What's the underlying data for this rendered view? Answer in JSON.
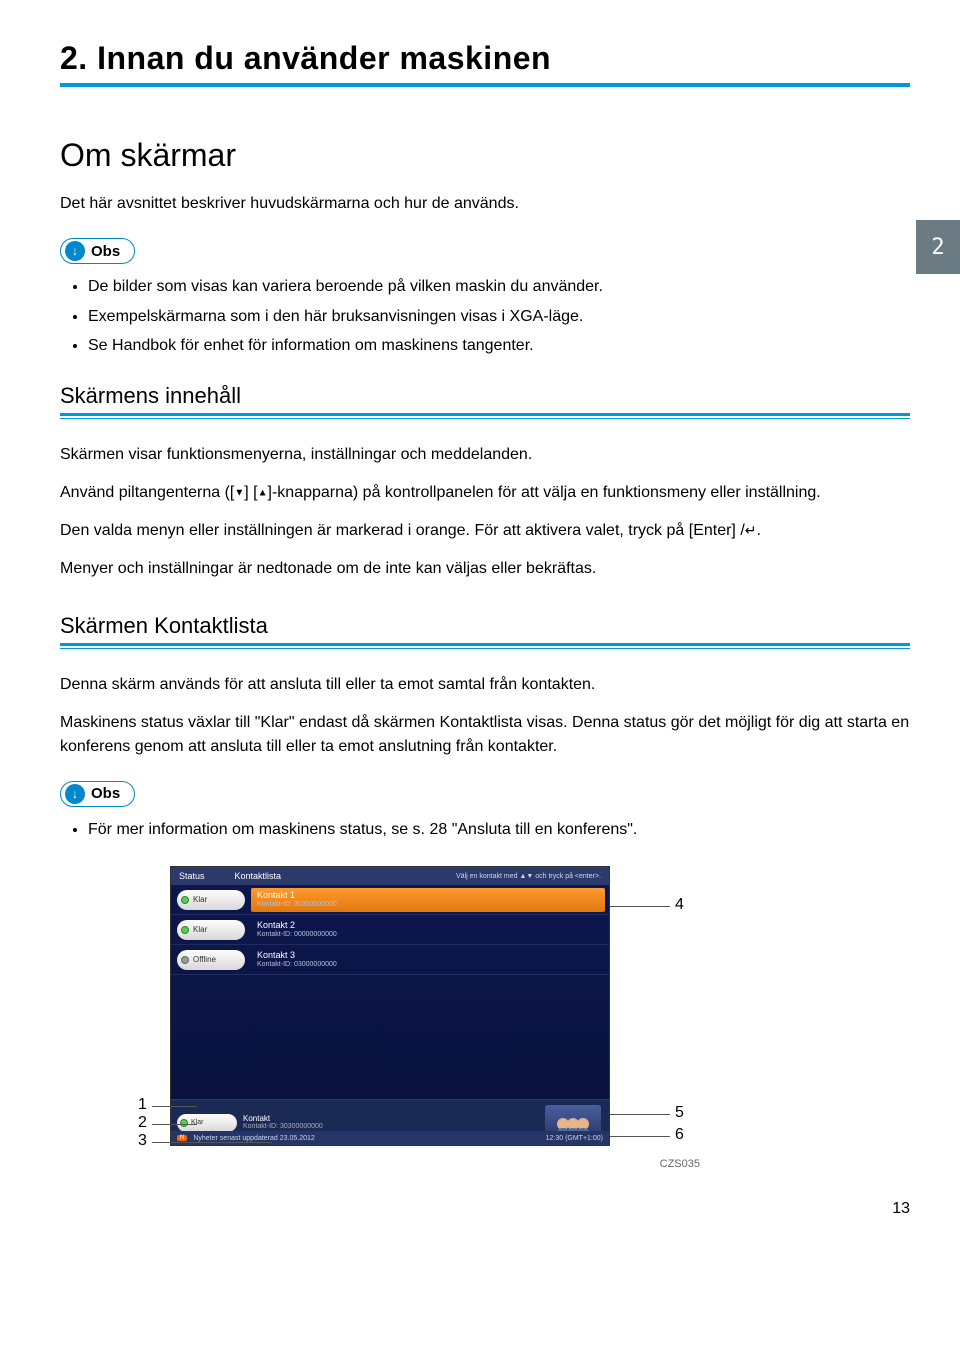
{
  "chapter": {
    "title": "2. Innan du använder maskinen"
  },
  "side_tab": "2",
  "section": {
    "title": "Om skärmar",
    "intro": "Det här avsnittet beskriver huvudskärmarna och hur de används."
  },
  "obs_label": "Obs",
  "obs1_bullets": [
    "De bilder som visas kan variera beroende på vilken maskin du använder.",
    "Exempelskärmarna som i den här bruksanvisningen visas i XGA-läge.",
    "Se Handbok för enhet för information om maskinens tangenter."
  ],
  "sub1": {
    "title": "Skärmens innehåll",
    "p1": "Skärmen visar funktionsmenyerna, inställningar och meddelanden.",
    "p2a": "Använd piltangenterna ([",
    "p2b": "] [",
    "p2c": "]-knapparna) på kontrollpanelen för att välja en funktionsmeny eller inställning.",
    "p3a": "Den valda menyn eller inställningen är markerad i orange. För att aktivera valet, tryck på [Enter] /",
    "p3b": ".",
    "p4": "Menyer och inställningar är nedtonade om de inte kan väljas eller bekräftas."
  },
  "sub2": {
    "title": "Skärmen Kontaktlista",
    "p1": "Denna skärm används för att ansluta till eller ta emot samtal från kontakten.",
    "p2": "Maskinens status växlar till \"Klar\" endast då skärmen Kontaktlista visas. Denna status gör det möjligt för dig att starta en konferens genom att ansluta till eller ta emot anslutning från kontakter."
  },
  "obs2_bullets": [
    "För mer information om maskinens status, se s. 28 \"Ansluta till en konferens\"."
  ],
  "screen": {
    "header_status": "Status",
    "header_contactlist": "Kontaktlista",
    "header_hint": "Välj en kontakt med ▲▼ och tryck på <enter>.",
    "status_klar": "Klar",
    "status_offline": "Offline",
    "contacts": [
      {
        "name": "Kontakt 1",
        "id": "Kontakt-ID: 30300000000"
      },
      {
        "name": "Kontakt 2",
        "id": "Kontakt-ID: 00000000000"
      },
      {
        "name": "Kontakt 3",
        "id": "Kontakt-ID: 03000000000"
      }
    ],
    "bottom_status": "Klar",
    "bottom_label": "Kontakt",
    "bottom_id": "Kontakt-ID: 30300000000",
    "news_label": "N",
    "news_text": "Nyheter senast uppdaterad 23.05.2012",
    "news_time": "12:30 (GMT+1:00)"
  },
  "callouts": {
    "n1": "1",
    "n2": "2",
    "n3": "3",
    "n4": "4",
    "n5": "5",
    "n6": "6"
  },
  "figure_code": "CZS035",
  "page_number": "13"
}
